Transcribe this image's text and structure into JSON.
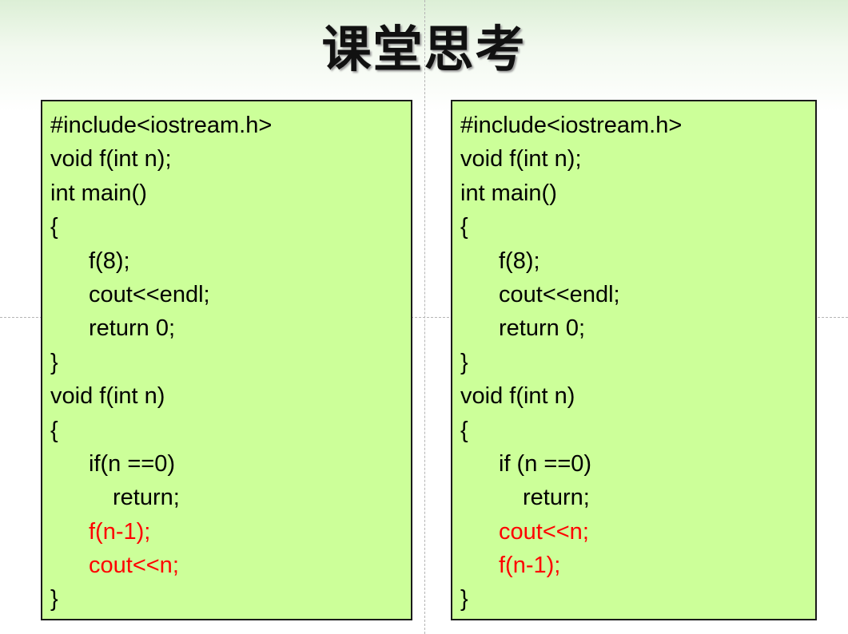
{
  "title": "课堂思考",
  "colors": {
    "panel_background": "#ccff99",
    "highlight_text": "#ff0000"
  },
  "left_code": [
    "#include<iostream.h>",
    "void f(int n);",
    "int main()",
    "{",
    "f(8);",
    "cout<<endl;",
    "return 0;",
    "}",
    "void f(int n)",
    "{",
    "if(n ==0)",
    "return;",
    "f(n-1);",
    "cout<<n;",
    "}"
  ],
  "right_code": [
    "#include<iostream.h>",
    "void f(int n);",
    "int main()",
    "{",
    "f(8);",
    "cout<<endl;",
    "return 0;",
    "}",
    "void f(int n)",
    "{",
    "if (n ==0)",
    "return;",
    "cout<<n;",
    "f(n-1);",
    "}"
  ]
}
